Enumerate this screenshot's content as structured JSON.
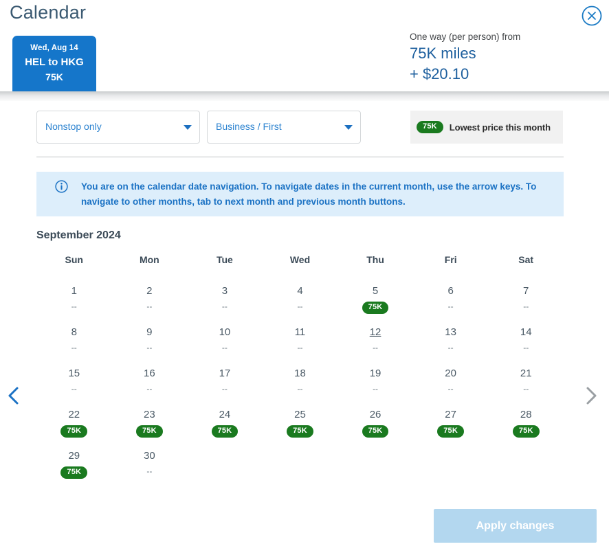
{
  "header": {
    "title": "Calendar",
    "close_icon": "close-circle-icon",
    "flight_tab": {
      "date": "Wed, Aug 14",
      "route": "HEL to HKG",
      "miles": "75K"
    },
    "price": {
      "label": "One way (per person) from",
      "miles": "75K miles",
      "cash": "+ $20.10"
    }
  },
  "filters": {
    "stops": {
      "value": "Nonstop only",
      "caret_icon": "chevron-down-icon"
    },
    "cabin": {
      "value": "Business / First",
      "caret_icon": "chevron-down-icon"
    },
    "legend": {
      "pill": "75K",
      "text": "Lowest price this month"
    }
  },
  "info_banner": {
    "icon": "info-circle-icon",
    "text": "You are on the calendar date navigation. To navigate dates in the current month, use the arrow keys. To navigate to other months, tab to next month and previous month buttons."
  },
  "calendar": {
    "month_title": "September 2024",
    "weekdays": [
      "Sun",
      "Mon",
      "Tue",
      "Wed",
      "Thu",
      "Fri",
      "Sat"
    ],
    "empty_value": "--",
    "prev_icon": "chevron-left-icon",
    "next_icon": "chevron-right-icon",
    "weeks": [
      [
        {
          "day": "1",
          "value": "--",
          "has_pill": false,
          "focused": false
        },
        {
          "day": "2",
          "value": "--",
          "has_pill": false,
          "focused": false
        },
        {
          "day": "3",
          "value": "--",
          "has_pill": false,
          "focused": false
        },
        {
          "day": "4",
          "value": "--",
          "has_pill": false,
          "focused": false
        },
        {
          "day": "5",
          "value": "75K",
          "has_pill": true,
          "focused": false
        },
        {
          "day": "6",
          "value": "--",
          "has_pill": false,
          "focused": false
        },
        {
          "day": "7",
          "value": "--",
          "has_pill": false,
          "focused": false
        }
      ],
      [
        {
          "day": "8",
          "value": "--",
          "has_pill": false,
          "focused": false
        },
        {
          "day": "9",
          "value": "--",
          "has_pill": false,
          "focused": false
        },
        {
          "day": "10",
          "value": "--",
          "has_pill": false,
          "focused": false
        },
        {
          "day": "11",
          "value": "--",
          "has_pill": false,
          "focused": false
        },
        {
          "day": "12",
          "value": "--",
          "has_pill": false,
          "focused": true
        },
        {
          "day": "13",
          "value": "--",
          "has_pill": false,
          "focused": false
        },
        {
          "day": "14",
          "value": "--",
          "has_pill": false,
          "focused": false
        }
      ],
      [
        {
          "day": "15",
          "value": "--",
          "has_pill": false,
          "focused": false
        },
        {
          "day": "16",
          "value": "--",
          "has_pill": false,
          "focused": false
        },
        {
          "day": "17",
          "value": "--",
          "has_pill": false,
          "focused": false
        },
        {
          "day": "18",
          "value": "--",
          "has_pill": false,
          "focused": false
        },
        {
          "day": "19",
          "value": "--",
          "has_pill": false,
          "focused": false
        },
        {
          "day": "20",
          "value": "--",
          "has_pill": false,
          "focused": false
        },
        {
          "day": "21",
          "value": "--",
          "has_pill": false,
          "focused": false
        }
      ],
      [
        {
          "day": "22",
          "value": "75K",
          "has_pill": true,
          "focused": false
        },
        {
          "day": "23",
          "value": "75K",
          "has_pill": true,
          "focused": false
        },
        {
          "day": "24",
          "value": "75K",
          "has_pill": true,
          "focused": false
        },
        {
          "day": "25",
          "value": "75K",
          "has_pill": true,
          "focused": false
        },
        {
          "day": "26",
          "value": "75K",
          "has_pill": true,
          "focused": false
        },
        {
          "day": "27",
          "value": "75K",
          "has_pill": true,
          "focused": false
        },
        {
          "day": "28",
          "value": "75K",
          "has_pill": true,
          "focused": false
        }
      ],
      [
        {
          "day": "29",
          "value": "75K",
          "has_pill": true,
          "focused": false
        },
        {
          "day": "30",
          "value": "--",
          "has_pill": false,
          "focused": false
        },
        null,
        null,
        null,
        null,
        null
      ]
    ]
  },
  "footer": {
    "apply_label": "Apply changes"
  },
  "colors": {
    "brand_blue": "#1576ca",
    "link_blue": "#2e84d0",
    "pill_green": "#1a7a1f",
    "banner_blue": "#ddeefb",
    "apply_disabled": "#b3d7ef"
  }
}
